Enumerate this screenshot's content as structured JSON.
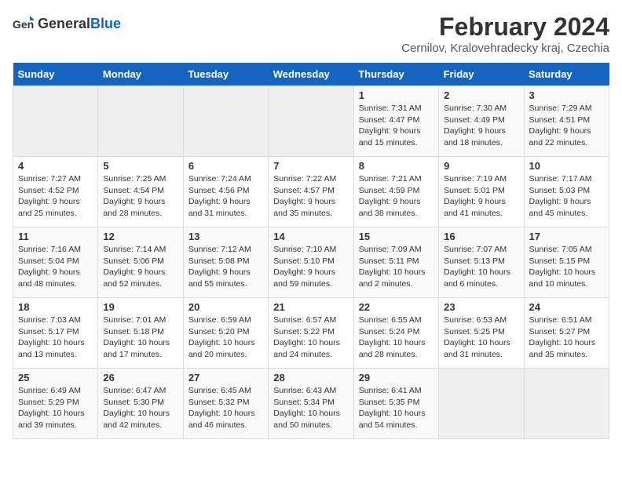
{
  "logo": {
    "general": "General",
    "blue": "Blue"
  },
  "title": "February 2024",
  "subtitle": "Cernilov, Kralovehradecky kraj, Czechia",
  "days_of_week": [
    "Sunday",
    "Monday",
    "Tuesday",
    "Wednesday",
    "Thursday",
    "Friday",
    "Saturday"
  ],
  "weeks": [
    [
      {
        "day": "",
        "info": ""
      },
      {
        "day": "",
        "info": ""
      },
      {
        "day": "",
        "info": ""
      },
      {
        "day": "",
        "info": ""
      },
      {
        "day": "1",
        "info": "Sunrise: 7:31 AM\nSunset: 4:47 PM\nDaylight: 9 hours\nand 15 minutes."
      },
      {
        "day": "2",
        "info": "Sunrise: 7:30 AM\nSunset: 4:49 PM\nDaylight: 9 hours\nand 18 minutes."
      },
      {
        "day": "3",
        "info": "Sunrise: 7:29 AM\nSunset: 4:51 PM\nDaylight: 9 hours\nand 22 minutes."
      }
    ],
    [
      {
        "day": "4",
        "info": "Sunrise: 7:27 AM\nSunset: 4:52 PM\nDaylight: 9 hours\nand 25 minutes."
      },
      {
        "day": "5",
        "info": "Sunrise: 7:25 AM\nSunset: 4:54 PM\nDaylight: 9 hours\nand 28 minutes."
      },
      {
        "day": "6",
        "info": "Sunrise: 7:24 AM\nSunset: 4:56 PM\nDaylight: 9 hours\nand 31 minutes."
      },
      {
        "day": "7",
        "info": "Sunrise: 7:22 AM\nSunset: 4:57 PM\nDaylight: 9 hours\nand 35 minutes."
      },
      {
        "day": "8",
        "info": "Sunrise: 7:21 AM\nSunset: 4:59 PM\nDaylight: 9 hours\nand 38 minutes."
      },
      {
        "day": "9",
        "info": "Sunrise: 7:19 AM\nSunset: 5:01 PM\nDaylight: 9 hours\nand 41 minutes."
      },
      {
        "day": "10",
        "info": "Sunrise: 7:17 AM\nSunset: 5:03 PM\nDaylight: 9 hours\nand 45 minutes."
      }
    ],
    [
      {
        "day": "11",
        "info": "Sunrise: 7:16 AM\nSunset: 5:04 PM\nDaylight: 9 hours\nand 48 minutes."
      },
      {
        "day": "12",
        "info": "Sunrise: 7:14 AM\nSunset: 5:06 PM\nDaylight: 9 hours\nand 52 minutes."
      },
      {
        "day": "13",
        "info": "Sunrise: 7:12 AM\nSunset: 5:08 PM\nDaylight: 9 hours\nand 55 minutes."
      },
      {
        "day": "14",
        "info": "Sunrise: 7:10 AM\nSunset: 5:10 PM\nDaylight: 9 hours\nand 59 minutes."
      },
      {
        "day": "15",
        "info": "Sunrise: 7:09 AM\nSunset: 5:11 PM\nDaylight: 10 hours\nand 2 minutes."
      },
      {
        "day": "16",
        "info": "Sunrise: 7:07 AM\nSunset: 5:13 PM\nDaylight: 10 hours\nand 6 minutes."
      },
      {
        "day": "17",
        "info": "Sunrise: 7:05 AM\nSunset: 5:15 PM\nDaylight: 10 hours\nand 10 minutes."
      }
    ],
    [
      {
        "day": "18",
        "info": "Sunrise: 7:03 AM\nSunset: 5:17 PM\nDaylight: 10 hours\nand 13 minutes."
      },
      {
        "day": "19",
        "info": "Sunrise: 7:01 AM\nSunset: 5:18 PM\nDaylight: 10 hours\nand 17 minutes."
      },
      {
        "day": "20",
        "info": "Sunrise: 6:59 AM\nSunset: 5:20 PM\nDaylight: 10 hours\nand 20 minutes."
      },
      {
        "day": "21",
        "info": "Sunrise: 6:57 AM\nSunset: 5:22 PM\nDaylight: 10 hours\nand 24 minutes."
      },
      {
        "day": "22",
        "info": "Sunrise: 6:55 AM\nSunset: 5:24 PM\nDaylight: 10 hours\nand 28 minutes."
      },
      {
        "day": "23",
        "info": "Sunrise: 6:53 AM\nSunset: 5:25 PM\nDaylight: 10 hours\nand 31 minutes."
      },
      {
        "day": "24",
        "info": "Sunrise: 6:51 AM\nSunset: 5:27 PM\nDaylight: 10 hours\nand 35 minutes."
      }
    ],
    [
      {
        "day": "25",
        "info": "Sunrise: 6:49 AM\nSunset: 5:29 PM\nDaylight: 10 hours\nand 39 minutes."
      },
      {
        "day": "26",
        "info": "Sunrise: 6:47 AM\nSunset: 5:30 PM\nDaylight: 10 hours\nand 42 minutes."
      },
      {
        "day": "27",
        "info": "Sunrise: 6:45 AM\nSunset: 5:32 PM\nDaylight: 10 hours\nand 46 minutes."
      },
      {
        "day": "28",
        "info": "Sunrise: 6:43 AM\nSunset: 5:34 PM\nDaylight: 10 hours\nand 50 minutes."
      },
      {
        "day": "29",
        "info": "Sunrise: 6:41 AM\nSunset: 5:35 PM\nDaylight: 10 hours\nand 54 minutes."
      },
      {
        "day": "",
        "info": ""
      },
      {
        "day": "",
        "info": ""
      }
    ]
  ]
}
